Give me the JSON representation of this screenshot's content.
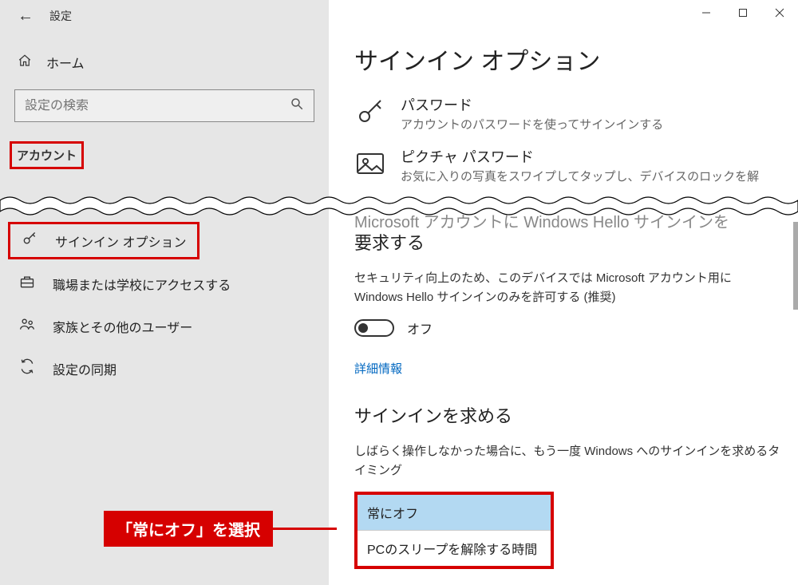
{
  "titlebar": {
    "title": "設定"
  },
  "sidebar": {
    "home": "ホーム",
    "search_placeholder": "設定の検索",
    "category": "アカウント",
    "items": [
      {
        "label": "サインイン オプション"
      },
      {
        "label": "職場または学校にアクセスする"
      },
      {
        "label": "家族とその他のユーザー"
      },
      {
        "label": "設定の同期"
      }
    ]
  },
  "content": {
    "page_title": "サインイン オプション",
    "options": [
      {
        "title": "パスワード",
        "desc": "アカウントのパスワードを使ってサインインする"
      },
      {
        "title": "ピクチャ パスワード",
        "desc": "お気に入りの写真をスワイプしてタップし、デバイスのロックを解"
      }
    ],
    "partial_heading_top": "Microsoft アカウントに Windows Hello サインインを",
    "hello_heading": "要求する",
    "hello_body": "セキュリティ向上のため、このデバイスでは Microsoft アカウント用に Windows Hello サインインのみを許可する (推奨)",
    "toggle_label": "オフ",
    "more_info": "詳細情報",
    "require_signin_heading": "サインインを求める",
    "require_signin_body": "しばらく操作しなかった場合に、もう一度 Windows へのサインインを求めるタイミング",
    "dropdown": [
      "常にオフ",
      "PCのスリープを解除する時間"
    ]
  },
  "callout": "「常にオフ」を選択"
}
